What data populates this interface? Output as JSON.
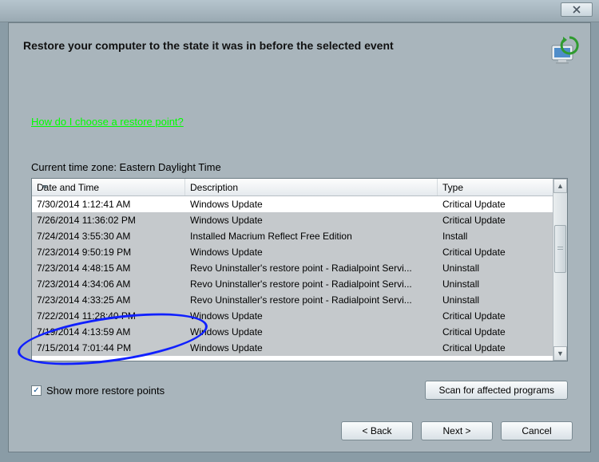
{
  "header": {
    "title": "Restore your computer to the state it was in before the selected event"
  },
  "help_link": "How do I choose a restore point?",
  "timezone": {
    "label": "Current time zone: ",
    "value": "Eastern Daylight Time"
  },
  "table": {
    "columns": {
      "date": "Date and Time",
      "desc": "Description",
      "type": "Type"
    },
    "rows": [
      {
        "date": "7/30/2014 1:12:41 AM",
        "desc": "Windows Update",
        "type": "Critical Update",
        "selected": false
      },
      {
        "date": "7/26/2014 11:36:02 PM",
        "desc": "Windows Update",
        "type": "Critical Update",
        "selected": true
      },
      {
        "date": "7/24/2014 3:55:30 AM",
        "desc": "Installed Macrium Reflect Free Edition",
        "type": "Install",
        "selected": true
      },
      {
        "date": "7/23/2014 9:50:19 PM",
        "desc": "Windows Update",
        "type": "Critical Update",
        "selected": true
      },
      {
        "date": "7/23/2014 4:48:15 AM",
        "desc": "Revo Uninstaller's restore point - Radialpoint Servi...",
        "type": "Uninstall",
        "selected": true
      },
      {
        "date": "7/23/2014 4:34:06 AM",
        "desc": "Revo Uninstaller's restore point - Radialpoint Servi...",
        "type": "Uninstall",
        "selected": true
      },
      {
        "date": "7/23/2014 4:33:25 AM",
        "desc": "Revo Uninstaller's restore point - Radialpoint Servi...",
        "type": "Uninstall",
        "selected": true
      },
      {
        "date": "7/22/2014 11:28:40 PM",
        "desc": "Windows Update",
        "type": "Critical Update",
        "selected": true
      },
      {
        "date": "7/19/2014 4:13:59 AM",
        "desc": "Windows Update",
        "type": "Critical Update",
        "selected": true
      },
      {
        "date": "7/15/2014 7:01:44 PM",
        "desc": "Windows Update",
        "type": "Critical Update",
        "selected": true
      }
    ]
  },
  "show_more": {
    "checked": true,
    "label": "Show more restore points"
  },
  "scan_button": "Scan for affected programs",
  "footer": {
    "back": "< Back",
    "next": "Next >",
    "cancel": "Cancel"
  }
}
